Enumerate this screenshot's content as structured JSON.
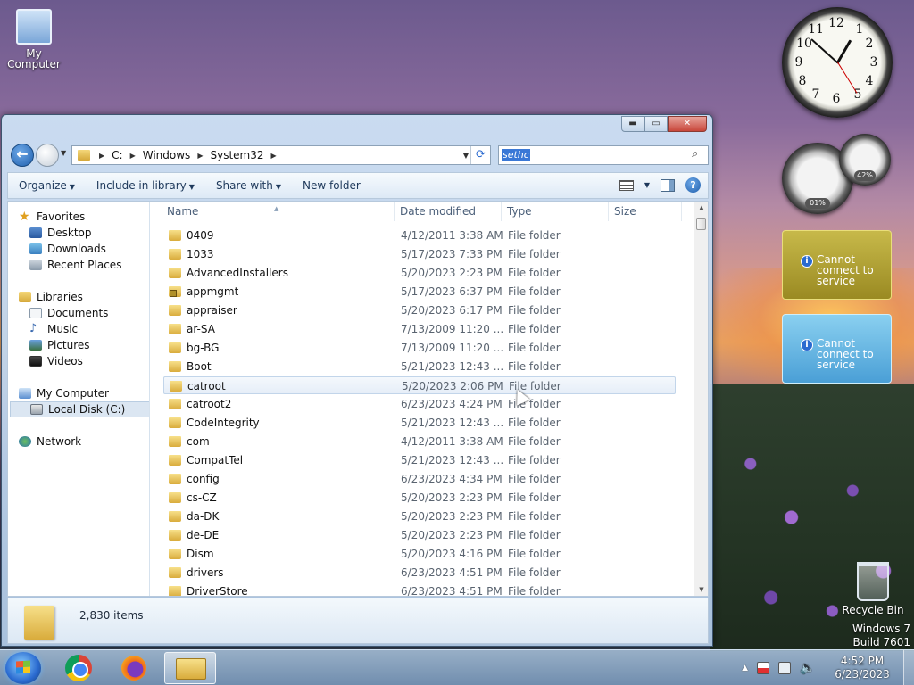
{
  "desktop": {
    "icons": {
      "my_computer": "My Computer",
      "recycle_bin": "Recycle Bin"
    },
    "watermark": {
      "line1": "Windows 7",
      "line2": "Build 7601"
    }
  },
  "gadgets": {
    "clock_numbers": [
      "12",
      "1",
      "2",
      "3",
      "4",
      "5",
      "6",
      "7",
      "8",
      "9",
      "10",
      "11"
    ],
    "cpu_meter": {
      "cpu": "01%",
      "memory": "42%"
    },
    "weather": [
      {
        "message": "Cannot connect to service"
      },
      {
        "message": "Cannot connect to service"
      }
    ]
  },
  "window": {
    "nav": {
      "back": "back",
      "forward": "forward"
    },
    "address": {
      "crumbs": [
        "C:",
        "Windows",
        "System32"
      ]
    },
    "search": {
      "value": "sethc"
    },
    "toolbar": {
      "organize": "Organize",
      "include_in_library": "Include in library",
      "share_with": "Share with",
      "new_folder": "New folder"
    },
    "navpane": {
      "favorites": "Favorites",
      "desktop": "Desktop",
      "downloads": "Downloads",
      "recent_places": "Recent Places",
      "libraries": "Libraries",
      "documents": "Documents",
      "music": "Music",
      "pictures": "Pictures",
      "videos": "Videos",
      "my_computer": "My Computer",
      "local_disk": "Local Disk (C:)",
      "network": "Network"
    },
    "columns": {
      "name": "Name",
      "date_modified": "Date modified",
      "type": "Type",
      "size": "Size"
    },
    "files": [
      {
        "name": "0409",
        "date": "4/12/2011 3:38 AM",
        "type": "File folder"
      },
      {
        "name": "1033",
        "date": "5/17/2023 7:33 PM",
        "type": "File folder"
      },
      {
        "name": "AdvancedInstallers",
        "date": "5/20/2023 2:23 PM",
        "type": "File folder"
      },
      {
        "name": "appmgmt",
        "date": "5/17/2023 6:37 PM",
        "type": "File folder",
        "locked": true
      },
      {
        "name": "appraiser",
        "date": "5/20/2023 6:17 PM",
        "type": "File folder"
      },
      {
        "name": "ar-SA",
        "date": "7/13/2009 11:20 ...",
        "type": "File folder"
      },
      {
        "name": "bg-BG",
        "date": "7/13/2009 11:20 ...",
        "type": "File folder"
      },
      {
        "name": "Boot",
        "date": "5/21/2023 12:43 ...",
        "type": "File folder"
      },
      {
        "name": "catroot",
        "date": "5/20/2023 2:06 PM",
        "type": "File folder",
        "hover": true
      },
      {
        "name": "catroot2",
        "date": "6/23/2023 4:24 PM",
        "type": "File folder"
      },
      {
        "name": "CodeIntegrity",
        "date": "5/21/2023 12:43 ...",
        "type": "File folder"
      },
      {
        "name": "com",
        "date": "4/12/2011 3:38 AM",
        "type": "File folder"
      },
      {
        "name": "CompatTel",
        "date": "5/21/2023 12:43 ...",
        "type": "File folder"
      },
      {
        "name": "config",
        "date": "6/23/2023 4:34 PM",
        "type": "File folder"
      },
      {
        "name": "cs-CZ",
        "date": "5/20/2023 2:23 PM",
        "type": "File folder"
      },
      {
        "name": "da-DK",
        "date": "5/20/2023 2:23 PM",
        "type": "File folder"
      },
      {
        "name": "de-DE",
        "date": "5/20/2023 2:23 PM",
        "type": "File folder"
      },
      {
        "name": "Dism",
        "date": "5/20/2023 4:16 PM",
        "type": "File folder"
      },
      {
        "name": "drivers",
        "date": "6/23/2023 4:51 PM",
        "type": "File folder"
      },
      {
        "name": "DriverStore",
        "date": "6/23/2023 4:51 PM",
        "type": "File folder"
      }
    ],
    "details": {
      "item_count": "2,830 items"
    }
  },
  "taskbar": {
    "apps": [
      "Google Chrome",
      "Firefox",
      "Windows Explorer"
    ],
    "time": "4:52 PM",
    "date": "6/23/2023"
  }
}
